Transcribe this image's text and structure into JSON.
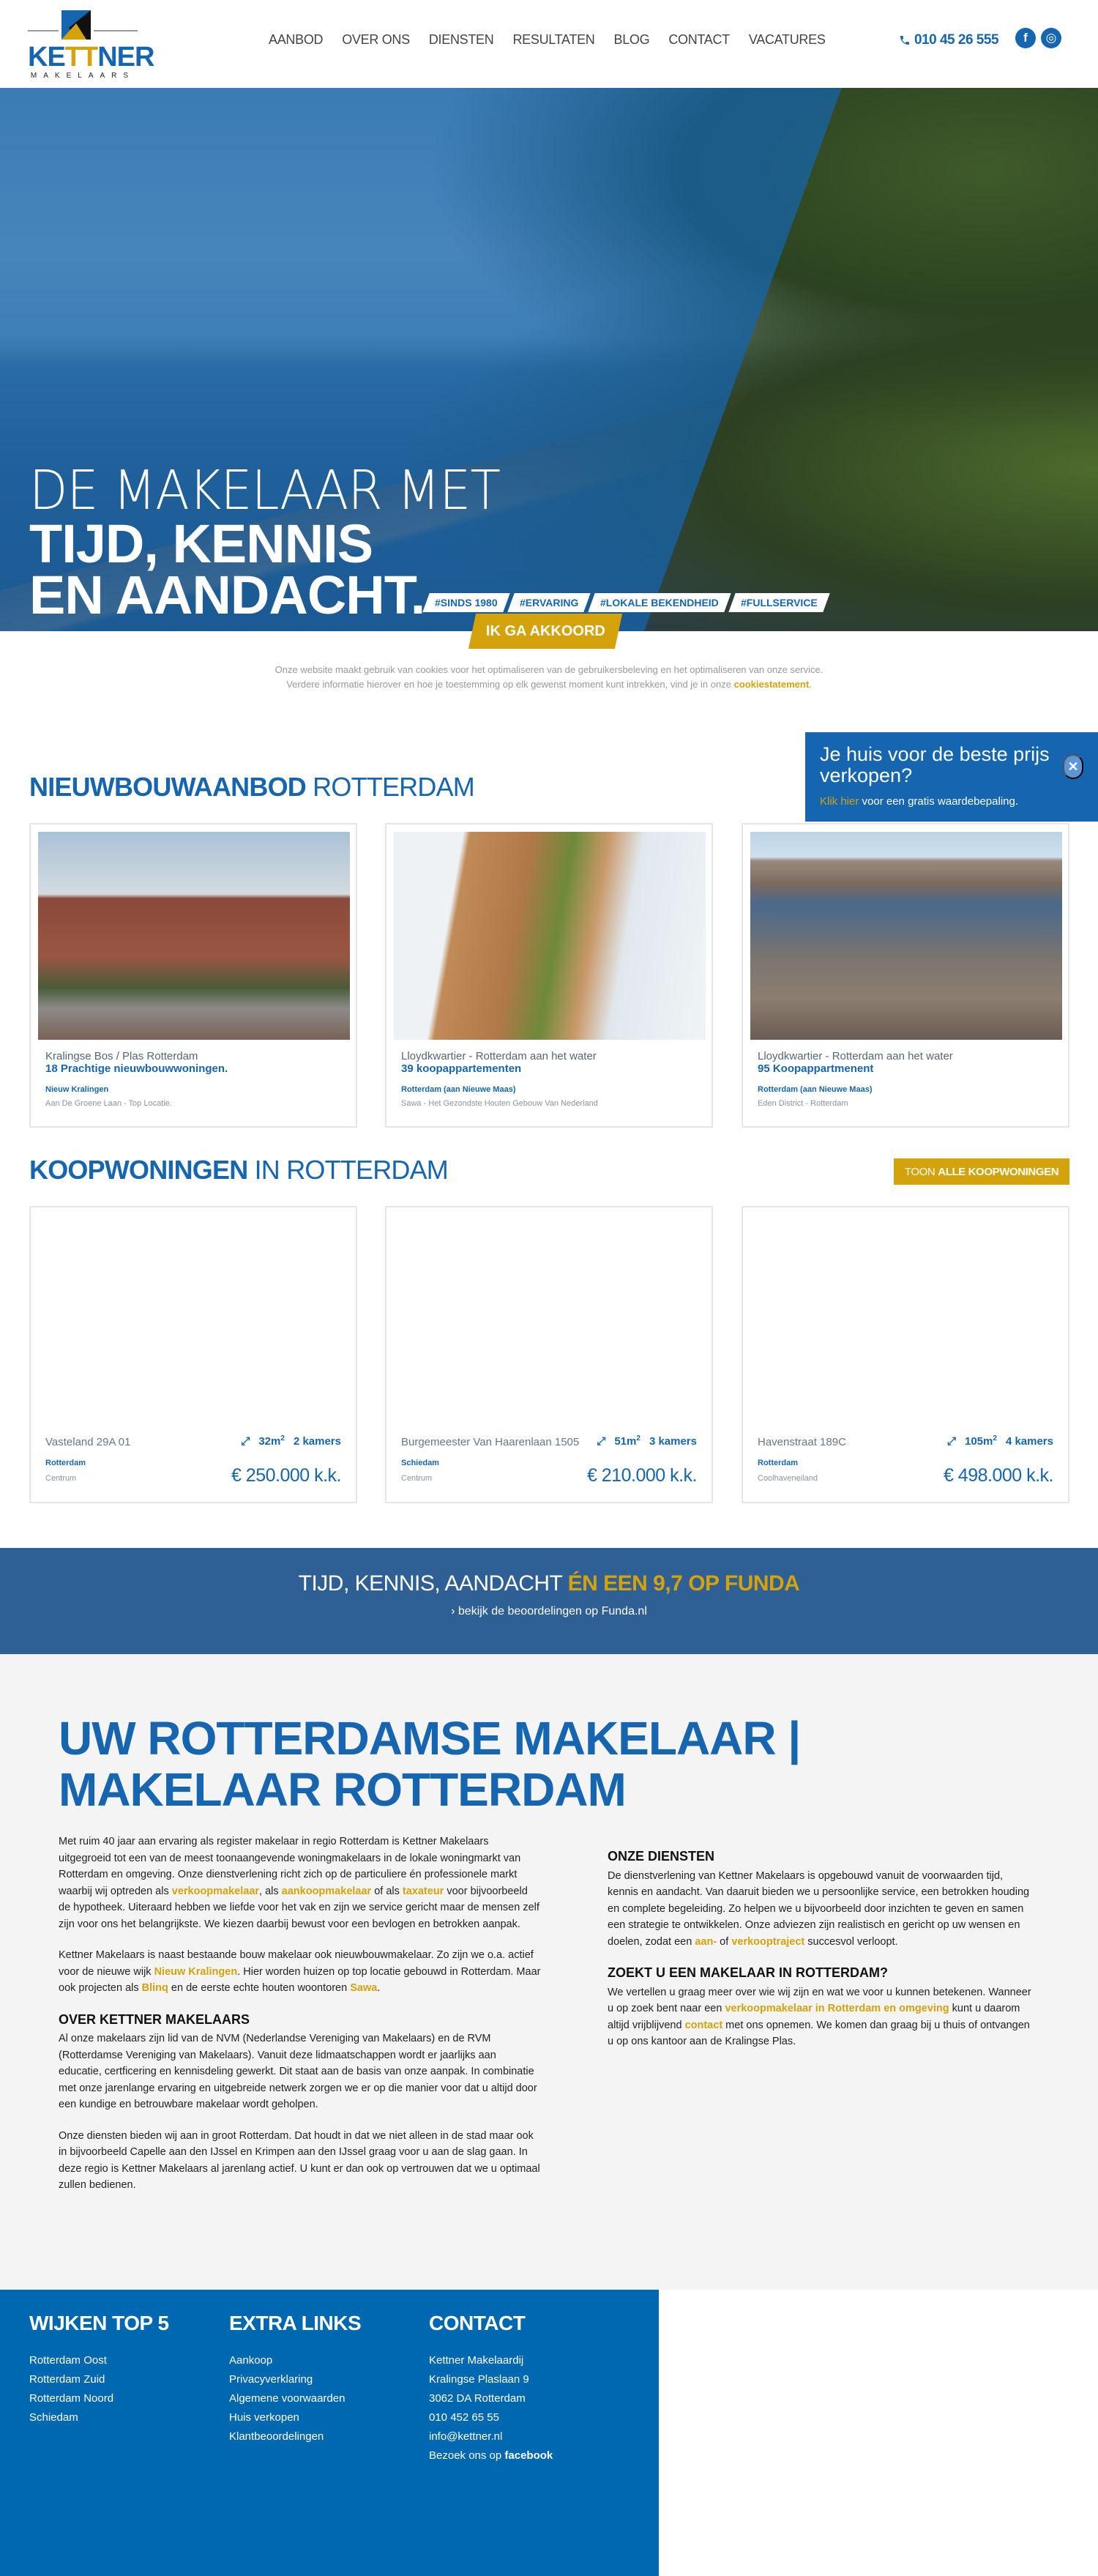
{
  "header": {
    "logo": {
      "name": "KETTNER",
      "name_pre": "KE",
      "name_gold": "TT",
      "name_post": "NER",
      "sub": "MAKELAARS"
    },
    "nav": [
      "AANBOD",
      "OVER ONS",
      "DIENSTEN",
      "RESULTATEN",
      "BLOG",
      "CONTACT",
      "VACATURES"
    ],
    "phone": "010 45 26 555",
    "social": {
      "facebook": "f",
      "instagram": "◎"
    }
  },
  "hero": {
    "line1": "DE MAKELAAR MET",
    "line2": "TIJD, KENNIS",
    "line3": "EN AANDACHT.",
    "tags": [
      "#SINDS 1980",
      "#ERVARING",
      "#LOKALE BEKENDHEID",
      "#FULLSERVICE"
    ]
  },
  "cookie": {
    "accept_label": "IK GA AKKOORD",
    "text": "Onze website maakt gebruik van cookies voor het optimaliseren van de gebruikersbeleving en het optimaliseren van onze service. Verdere informatie hierover en hoe je toestemming op elk gewenst moment kunt intrekken, vind je in onze ",
    "link": "cookiestatement",
    "end": "."
  },
  "popup": {
    "title": "Je huis voor de beste prijs verkopen?",
    "link": "Klik hier",
    "text": " voor een gratis waardebepaling.",
    "close": "✕"
  },
  "nieuwbouw": {
    "title_bold": "NIEUWBOUWAANBOD",
    "title_light": " ROTTERDAM",
    "cards": [
      {
        "location": "Kralingse Bos / Plas Rotterdam",
        "title": "18 Prachtige nieuwbouwwoningen.",
        "area": "Nieuw Kralingen",
        "desc": "Aan De Groene Laan - Top Locatie."
      },
      {
        "location": "Lloydkwartier - Rotterdam aan het water",
        "title": "39 koopappartementen",
        "area": "Rotterdam (aan Nieuwe Maas)",
        "desc": "Sawa - Het Gezondste Houten Gebouw Van Nederland"
      },
      {
        "location": "Lloydkwartier - Rotterdam aan het water",
        "title": "95 Koopappartmenent",
        "area": "Rotterdam (aan Nieuwe Maas)",
        "desc": "Eden District - Rotterdam"
      }
    ]
  },
  "koopwoningen": {
    "title_bold": "KOOPWONINGEN",
    "title_light": " IN ROTTERDAM",
    "button_light": "TOON",
    "button_bold": "ALLE KOOPWONINGEN",
    "cards": [
      {
        "address": "Vasteland 29A 01",
        "area_m2": "32m",
        "rooms": "2 kamers",
        "city": "Rotterdam",
        "district": "Centrum",
        "price": "€ 250.000 k.k."
      },
      {
        "address": "Burgemeester Van Haarenlaan 1505",
        "area_m2": "51m",
        "rooms": "3 kamers",
        "city": "Schiedam",
        "district": "Centrum",
        "price": "€ 210.000 k.k."
      },
      {
        "address": "Havenstraat 189C",
        "area_m2": "105m",
        "rooms": "4 kamers",
        "city": "Rotterdam",
        "district": "Coolhaveneiland",
        "price": "€ 498.000 k.k."
      }
    ],
    "sup": "2"
  },
  "funda": {
    "title_light": "TIJD, KENNIS, AANDACHT ",
    "title_bold": "ÉN EEN 9,7 OP FUNDA",
    "link": "› bekijk de beoordelingen op Funda.nl"
  },
  "about": {
    "title": "UW ROTTERDAMSE MAKELAAR | MAKELAAR ROTTERDAM",
    "p1": {
      "a": "Met ruim 40 jaar aan ervaring als register makelaar in regio Rotterdam is Kettner Makelaars uitgegroeid tot een van de meest toonaangevende woningmakelaars in de lokale woningmarkt van Rotterdam en omgeving. Onze dienstverlening richt zich op de particuliere én professionele markt waarbij wij optreden als ",
      "l1": "verkoopmakelaar",
      "b": ", als ",
      "l2": "aankoopmakelaar",
      "c": " of als ",
      "l3": "taxateur",
      "d": " voor bijvoorbeeld de hypotheek. Uiteraard hebben we liefde voor het vak en zijn we service gericht maar de mensen zelf zijn voor ons het belangrijkste. We kiezen daarbij bewust voor een bevlogen en betrokken aanpak."
    },
    "p2": {
      "a": "Kettner Makelaars is naast bestaande bouw makelaar ook nieuwbouwmakelaar. Zo zijn we o.a. actief voor de nieuwe wijk ",
      "l1": "Nieuw Kralingen",
      "b": ". Hier worden huizen op top locatie gebouwd in Rotterdam. Maar ook projecten als ",
      "l2": "Blinq",
      "c": " en de eerste echte houten woontoren ",
      "l3": "Sawa",
      "d": "."
    },
    "h_over": "OVER KETTNER MAKELAARS",
    "p3": "Al onze makelaars zijn lid van de NVM (Nederlandse Vereniging van Makelaars) en de RVM (Rotterdamse Vereniging van Makelaars). Vanuit deze lidmaatschappen wordt er jaarlijks aan educatie, certficering en kennisdeling gewerkt. Dit staat aan de basis van onze aanpak. In combinatie met onze jarenlange ervaring en uitgebreide netwerk zorgen we er op die manier voor dat u altijd door een kundige en betrouwbare makelaar wordt geholpen.",
    "p4": "Onze diensten bieden wij aan in groot Rotterdam. Dat houdt in dat we niet alleen in de stad maar ook in bijvoorbeeld Capelle aan den IJssel en Krimpen aan den IJssel graag voor u aan de slag gaan. In deze regio is Kettner Makelaars al jarenlang actief. U kunt er dan ook op vertrouwen dat we u optimaal zullen bedienen.",
    "h_diensten": "ONZE DIENSTEN",
    "p5": {
      "a": "De dienstverlening van Kettner Makelaars is opgebouwd vanuit de voorwaarden tijd, kennis en aandacht. Van daaruit bieden we u persoonlijke service, een betrokken houding en complete begeleiding. Zo helpen we u bijvoorbeeld door inzichten te geven en samen een strategie te ontwikkelen. Onze adviezen zijn realistisch en gericht op uw wensen en doelen, zodat een ",
      "l1": "aan-",
      "b": " of ",
      "l2": "verkooptraject",
      "c": " succesvol verloopt."
    },
    "h_zoekt": "ZOEKT U EEN MAKELAAR IN ROTTERDAM?",
    "p6": {
      "a": "We vertellen u graag meer over wie wij zijn en wat we voor u kunnen betekenen. Wanneer u op zoek bent naar een ",
      "l1": "verkoopmakelaar in Rotterdam en omgeving",
      "b": " kunt u daarom altijd vrijblijvend ",
      "l2": "contact",
      "c": " met ons opnemen. We komen dan graag bij u thuis of ontvangen u op ons kantoor aan de Kralingse Plas."
    }
  },
  "footer": {
    "wijken": {
      "title": "WIJKEN TOP 5",
      "items": [
        "Rotterdam Oost",
        "Rotterdam Zuid",
        "Rotterdam Noord",
        "Schiedam"
      ]
    },
    "links": {
      "title": "EXTRA LINKS",
      "items": [
        "Aankoop",
        "Privacyverklaring",
        "Algemene voorwaarden",
        "Huis verkopen",
        "Klantbeoordelingen"
      ]
    },
    "contact": {
      "title": "CONTACT",
      "items": [
        "Kettner Makelaardij",
        "Kralingse Plaslaan 9",
        "3062 DA Rotterdam",
        "010 452 65 55",
        "info@kettner.nl"
      ],
      "facebook_pre": "Bezoek ons op ",
      "facebook_link": "facebook"
    }
  },
  "colors": {
    "brand_blue": "#1565b0",
    "gold": "#d4a20b",
    "footer_blue": "#0067b1",
    "banner_blue": "#2e6096"
  }
}
